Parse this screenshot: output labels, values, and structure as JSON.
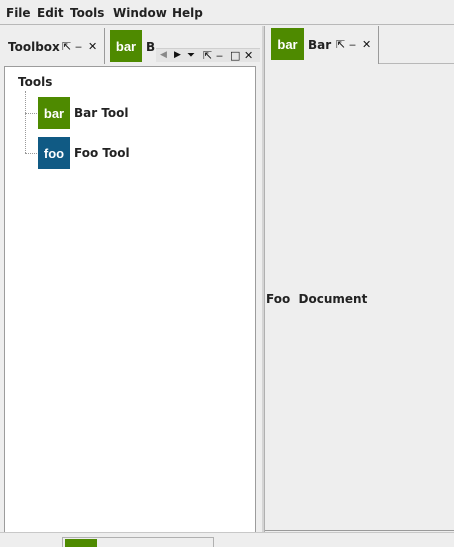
{
  "menu": {
    "items": [
      {
        "label": "File"
      },
      {
        "label": "Edit"
      },
      {
        "label": "Tools"
      },
      {
        "label": "Window"
      },
      {
        "label": "Help"
      }
    ]
  },
  "toolbox": {
    "title": "Toolbox",
    "controls": {
      "pin": "⇱",
      "minimize": "‒",
      "close": "✕"
    }
  },
  "bar_tab_partial": {
    "badge": "bar",
    "label": "B"
  },
  "tab_controls": {
    "prev": "◀",
    "next": "▶",
    "list": "⏷",
    "pin": "⇱",
    "minimize": "‒",
    "maximize": "□",
    "close": "✕"
  },
  "tree": {
    "root": "Tools",
    "items": [
      {
        "badge": "bar",
        "label": "Bar Tool"
      },
      {
        "badge": "foo",
        "label": "Foo Tool"
      }
    ]
  },
  "document": {
    "tab": {
      "badge": "bar",
      "label": "Bar"
    },
    "controls": {
      "pin": "⇱",
      "minimize": "‒",
      "close": "✕"
    },
    "content": "Foo  Document"
  },
  "colors": {
    "bar_badge": "#4e8a00",
    "foo_badge": "#105a84",
    "background": "#eeeeee"
  }
}
